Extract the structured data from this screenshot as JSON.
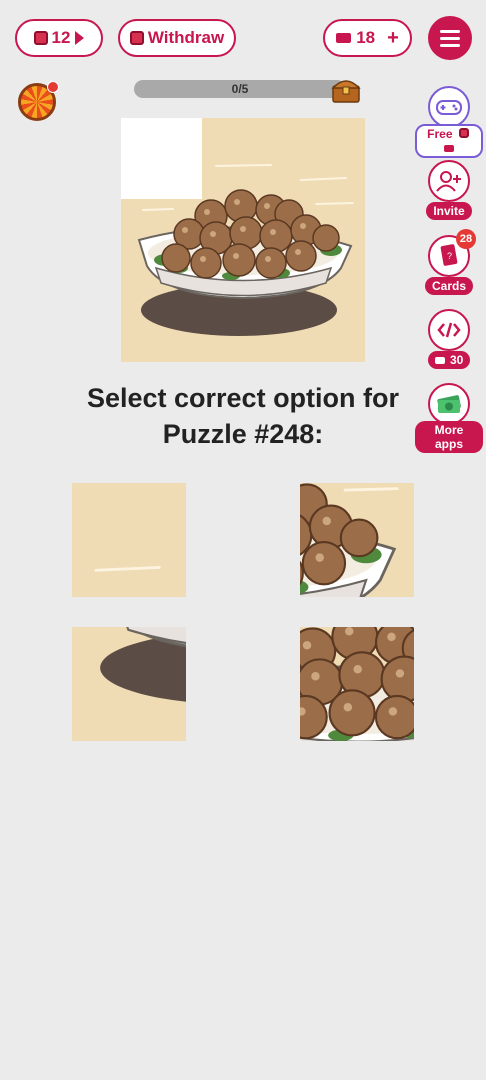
{
  "header": {
    "gems_count": "12",
    "withdraw_label": "Withdraw",
    "tickets_count": "18",
    "add_symbol": "+"
  },
  "progress": {
    "label": "0/5",
    "value": 0
  },
  "sidebar": {
    "free_label": "Free",
    "invite_label": "Invite",
    "cards_label": "Cards",
    "cards_badge": "28",
    "code_label": "30",
    "more_apps_label": "More apps"
  },
  "question": {
    "line1": "Select correct option for",
    "line2": "Puzzle #248:"
  },
  "colors": {
    "accent": "#c8164f",
    "background": "#ebebeb",
    "tile_bg": "#f0dcb4"
  }
}
